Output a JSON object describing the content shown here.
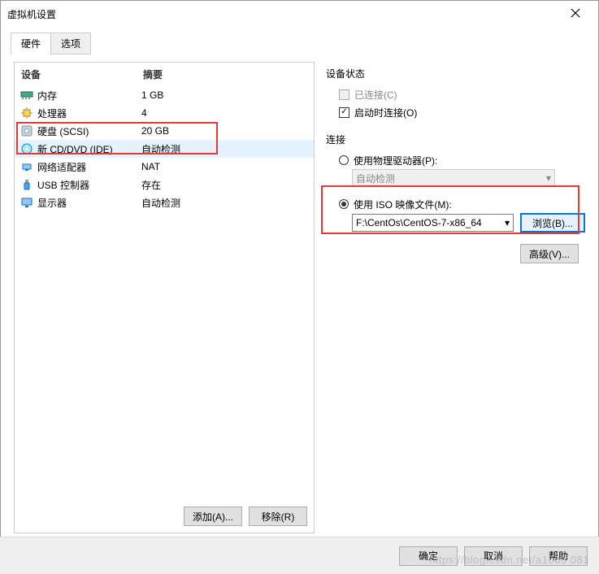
{
  "window": {
    "title": "虚拟机设置"
  },
  "tabs": {
    "hardware": "硬件",
    "options": "选项"
  },
  "hw_header": {
    "device": "设备",
    "summary": "摘要"
  },
  "hardware": [
    {
      "icon": "memory",
      "name": "内存",
      "summary": "1 GB"
    },
    {
      "icon": "cpu",
      "name": "处理器",
      "summary": "4"
    },
    {
      "icon": "disk",
      "name": "硬盘 (SCSI)",
      "summary": "20 GB"
    },
    {
      "icon": "cd",
      "name": "新 CD/DVD (IDE)",
      "summary": "自动检测",
      "selected": true
    },
    {
      "icon": "net",
      "name": "网络适配器",
      "summary": "NAT"
    },
    {
      "icon": "usb",
      "name": "USB 控制器",
      "summary": "存在"
    },
    {
      "icon": "display",
      "name": "显示器",
      "summary": "自动检测"
    }
  ],
  "buttons": {
    "add": "添加(A)...",
    "remove": "移除(R)"
  },
  "right": {
    "status_title": "设备状态",
    "connected": "已连接(C)",
    "connect_on_power": "启动时连接(O)",
    "conn_title": "连接",
    "use_physical": "使用物理驱动器(P):",
    "auto_detect": "自动检测",
    "use_iso": "使用 ISO 映像文件(M):",
    "iso_path": "F:\\CentOs\\CentOS-7-x86_64",
    "browse": "浏览(B)...",
    "advanced": "高级(V)..."
  },
  "footer": {
    "ok": "确定",
    "cancel": "取消",
    "help": "帮助"
  },
  "watermark": "https://blog.csdn.net/a1085 081"
}
